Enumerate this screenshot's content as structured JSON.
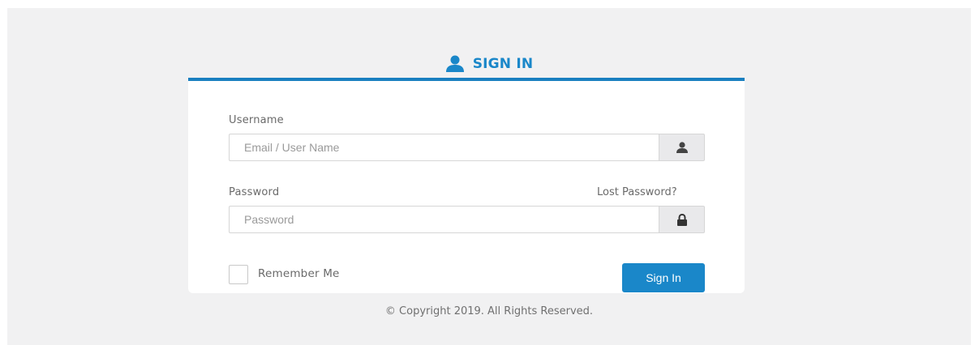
{
  "header": {
    "icon": "user-icon",
    "title": "SIGN IN",
    "accent_color": "#1a87c9"
  },
  "form": {
    "username": {
      "label": "Username",
      "placeholder": "Email / User Name",
      "value": "",
      "addon_icon": "user-icon"
    },
    "password": {
      "label": "Password",
      "placeholder": "Password",
      "value": "",
      "addon_icon": "lock-icon",
      "lost_link": "Lost Password?"
    },
    "remember": {
      "label": "Remember Me",
      "checked": false
    },
    "submit_label": "Sign In"
  },
  "footer": {
    "copyright": "© Copyright 2019. All Rights Reserved."
  }
}
